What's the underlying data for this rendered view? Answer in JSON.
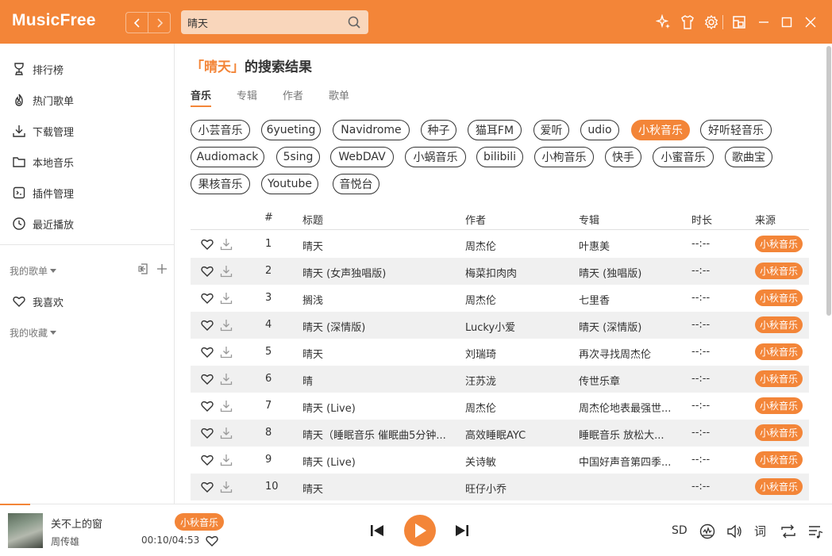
{
  "app": {
    "name": "MusicFree",
    "accent": "#f38538"
  },
  "header": {
    "back_icon": "chevron-left-icon",
    "forward_icon": "chevron-right-icon",
    "search_value": "晴天",
    "search_icon": "search-icon",
    "icons": [
      "sparkle-icon",
      "tshirt-icon",
      "gear-icon",
      "mini-mode-icon",
      "minimize-icon",
      "maximize-icon",
      "close-icon"
    ]
  },
  "sidebar": {
    "items": [
      {
        "label": "排行榜",
        "icon": "trophy-icon"
      },
      {
        "label": "热门歌单",
        "icon": "fire-icon"
      },
      {
        "label": "下载管理",
        "icon": "download-icon"
      },
      {
        "label": "本地音乐",
        "icon": "folder-icon"
      },
      {
        "label": "插件管理",
        "icon": "plugin-icon"
      },
      {
        "label": "最近播放",
        "icon": "clock-icon"
      }
    ],
    "my_playlists": "我的歌单",
    "favorites": "我喜欢",
    "my_collections": "我的收藏"
  },
  "main": {
    "title_open": "「",
    "title_keyword": "晴天",
    "title_close": "」",
    "title_suffix": "的搜索结果",
    "tabs": [
      "音乐",
      "专辑",
      "作者",
      "歌单"
    ],
    "plugins": [
      "小芸音乐",
      "6yueting",
      "Navidrome",
      "种子",
      "猫耳FM",
      "爱听",
      "udio",
      "小秋音乐",
      "好听轻音乐",
      "Audiomack",
      "5sing",
      "WebDAV",
      "小蜗音乐",
      "bilibili",
      "小枸音乐",
      "快手",
      "小蜜音乐",
      "歌曲宝",
      "果核音乐",
      "Youtube",
      "音悦台"
    ],
    "active_plugin": "小秋音乐",
    "columns": {
      "index": "#",
      "title": "标题",
      "artist": "作者",
      "album": "专辑",
      "duration": "时长",
      "source": "来源"
    },
    "rows": [
      {
        "index": "1",
        "title": "晴天",
        "artist": "周杰伦",
        "album": "叶惠美",
        "duration": "--:--",
        "source": "小秋音乐"
      },
      {
        "index": "2",
        "title": "晴天 (女声独唱版)",
        "artist": "梅菜扣肉肉",
        "album": "晴天 (独唱版)",
        "duration": "--:--",
        "source": "小秋音乐"
      },
      {
        "index": "3",
        "title": "搁浅",
        "artist": "周杰伦",
        "album": "七里香",
        "duration": "--:--",
        "source": "小秋音乐"
      },
      {
        "index": "4",
        "title": "晴天 (深情版)",
        "artist": "Lucky小爱",
        "album": "晴天 (深情版)",
        "duration": "--:--",
        "source": "小秋音乐"
      },
      {
        "index": "5",
        "title": "晴天",
        "artist": "刘瑞琦",
        "album": "再次寻找周杰伦",
        "duration": "--:--",
        "source": "小秋音乐"
      },
      {
        "index": "6",
        "title": "晴",
        "artist": "汪苏泷",
        "album": "传世乐章",
        "duration": "--:--",
        "source": "小秋音乐"
      },
      {
        "index": "7",
        "title": "晴天 (Live)",
        "artist": "周杰伦",
        "album": "周杰伦地表最强世...",
        "duration": "--:--",
        "source": "小秋音乐"
      },
      {
        "index": "8",
        "title": "晴天（睡眠音乐 催眠曲5分钟...",
        "artist": "高效睡眠AYC",
        "album": "睡眠音乐 放松大...",
        "duration": "--:--",
        "source": "小秋音乐"
      },
      {
        "index": "9",
        "title": "晴天 (Live)",
        "artist": "关诗敏",
        "album": "中国好声音第四季...",
        "duration": "--:--",
        "source": "小秋音乐"
      },
      {
        "index": "10",
        "title": "晴天",
        "artist": "旺仔小乔",
        "album": "",
        "duration": "--:--",
        "source": "小秋音乐"
      }
    ]
  },
  "player": {
    "song_title": "关不上的窗",
    "artist": "周传雄",
    "source": "小秋音乐",
    "time": "00:10/04:53",
    "progress": 0.034,
    "quality": "SD",
    "lyrics_label": "词"
  }
}
